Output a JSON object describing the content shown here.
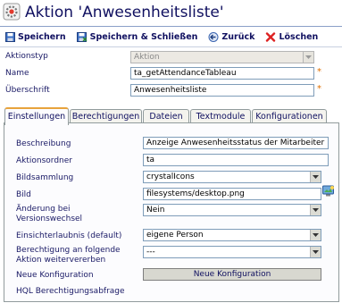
{
  "window": {
    "title": "Aktion 'Anwesenheitsliste'"
  },
  "toolbar": {
    "save": "Speichern",
    "save_close": "Speichern & Schließen",
    "back": "Zurück",
    "delete": "Löschen"
  },
  "header_form": {
    "aktionstyp_label": "Aktionstyp",
    "aktionstyp_value": "Aktion",
    "name_label": "Name",
    "name_value": "ta_getAttendanceTableau",
    "ueberschrift_label": "Überschrift",
    "ueberschrift_value": "Anwesenheitsliste",
    "required_mark": "*"
  },
  "tabs": [
    {
      "label": "Einstellungen"
    },
    {
      "label": "Berechtigungen"
    },
    {
      "label": "Dateien"
    },
    {
      "label": "Textmodule"
    },
    {
      "label": "Konfigurationen"
    }
  ],
  "settings": {
    "beschreibung_label": "Beschreibung",
    "beschreibung_value": "Anzeige Anwesenheitsstatus der Mitarbeiter",
    "aktionsordner_label": "Aktionsordner",
    "aktionsordner_value": "ta",
    "bildsammlung_label": "Bildsammlung",
    "bildsammlung_value": "crystalIcons",
    "bild_label": "Bild",
    "bild_value": "filesystems/desktop.png",
    "aenderung_label_1": "Änderung bei",
    "aenderung_label_2": "Versionswechsel",
    "aenderung_value": "Nein",
    "einsicht_label": "Einsichterlaubnis (default)",
    "einsicht_value": "eigene Person",
    "weitervererben_label_1": "Berechtigung an folgende",
    "weitervererben_label_2": "Aktion weitervererben",
    "weitervererben_value": "---",
    "neue_konfig_label": "Neue Konfiguration",
    "neue_konfig_button": "Neue Konfiguration",
    "hql_label": "HQL Berechtigungsabfrage"
  },
  "colors": {
    "accent_tab": "#e8a33c",
    "required": "#e07000",
    "text": "#1a1a66"
  }
}
